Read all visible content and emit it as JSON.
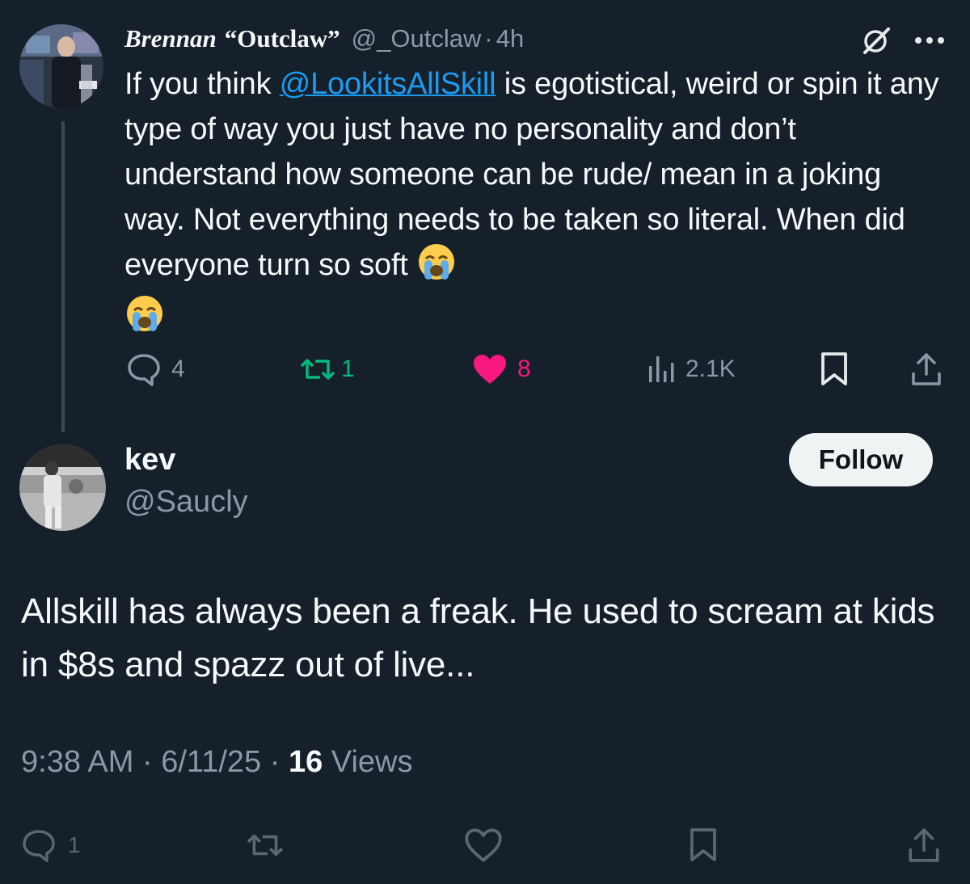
{
  "parent_tweet": {
    "display_name": "Brennan",
    "nickname": "“Outclaw”",
    "handle": "@_Outclaw",
    "time_ago": "4h",
    "text_before_mention": "If you think ",
    "mention": "@LookitsAllSkill",
    "text_after_mention": " is egotistical, weird or spin it any type of way you just have no personality and don’t understand how someone can be rude/ mean in a joking way. Not everything needs to be taken so literal. When did everyone turn so soft ",
    "emoji": "😭",
    "replies": "4",
    "reposts": "1",
    "likes": "8",
    "views": "2.1K",
    "icons": [
      "grok-icon",
      "more-icon",
      "reply-icon",
      "repost-icon",
      "like-icon-filled",
      "views-icon",
      "bookmark-icon",
      "share-icon"
    ]
  },
  "reply_tweet": {
    "display_name": "kev",
    "handle": "@Saucly",
    "follow_label": "Follow",
    "text": "Allskill has always been a freak. He used to scream at kids in $8s and spazz out of live...",
    "time": "9:38 AM",
    "date": "6/11/25",
    "views_count": "16",
    "views_label": "Views",
    "replies": "1",
    "icons": [
      "reply-icon",
      "repost-icon",
      "like-icon",
      "bookmark-icon",
      "share-icon"
    ]
  },
  "colors": {
    "background": "#15202b",
    "text": "#f7f9f9",
    "secondary": "#8b98a5",
    "link": "#1d9bf0",
    "repost_active": "#00ba7c",
    "like_active": "#f91880",
    "thread_line": "#3b4754"
  }
}
